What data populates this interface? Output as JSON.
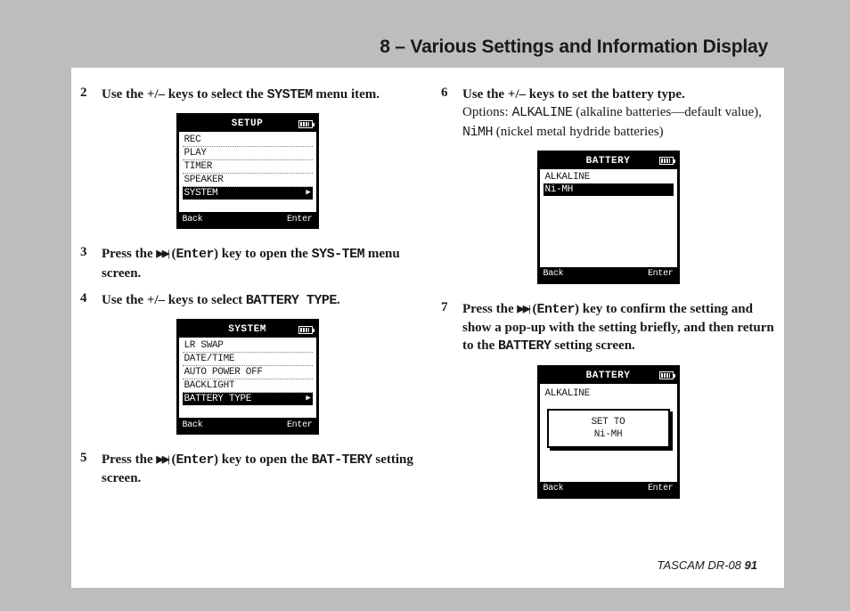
{
  "header": {
    "title": "8 – Various Settings and Information Display"
  },
  "footer": {
    "product": "TASCAM  DR-08",
    "page": "91"
  },
  "left": {
    "s2": {
      "num": "2",
      "pre": "Use the +/– keys to select the ",
      "mono": "SYSTEM",
      "post": " menu item."
    },
    "lcd_setup": {
      "title": "SETUP",
      "rows": [
        "REC",
        "PLAY",
        "TIMER",
        "SPEAKER"
      ],
      "sel": "SYSTEM",
      "back": "Back",
      "enter": "Enter"
    },
    "s3": {
      "num": "3",
      "pre": "Press the ",
      "enter_paren_open": "(",
      "enter_mono": "Enter",
      "enter_paren_close": ")",
      "mid": " key to open the ",
      "mono": "SYS-TEM",
      "post": " menu screen."
    },
    "s4": {
      "num": "4",
      "pre": "Use the +/– keys to select ",
      "mono": "BATTERY TYPE",
      "post": "."
    },
    "lcd_system": {
      "title": "SYSTEM",
      "rows": [
        "LR SWAP",
        "DATE/TIME",
        "AUTO POWER OFF",
        "BACKLIGHT"
      ],
      "sel": "BATTERY TYPE",
      "back": "Back",
      "enter": "Enter"
    },
    "s5": {
      "num": "5",
      "pre": "Press the ",
      "enter_paren_open": "(",
      "enter_mono": "Enter",
      "enter_paren_close": ")",
      "mid": " key to open the ",
      "mono": "BAT-TERY",
      "post": " setting screen."
    }
  },
  "right": {
    "s6": {
      "num": "6",
      "line1": "Use the +/– keys to set the battery type.",
      "opts_pre": "Options: ",
      "opt1_mono": "ALKALINE",
      "opt1_desc": " (alkaline batteries—default value), ",
      "opt2_mono": "NiMH",
      "opt2_desc": " (nickel metal hydride batteries)"
    },
    "lcd_batt": {
      "title": "BATTERY",
      "row1": "ALKALINE",
      "sel": "Ni-MH",
      "back": "Back",
      "enter": "Enter"
    },
    "s7": {
      "num": "7",
      "pre": "Press the ",
      "enter_paren_open": "(",
      "enter_mono": "Enter",
      "enter_paren_close": ")",
      "mid": " key to confirm the setting and show a pop-up with the setting briefly, and then return to the ",
      "mono": "BATTERY",
      "post": " setting screen."
    },
    "lcd_popup": {
      "title": "BATTERY",
      "row1": "ALKALINE",
      "popup_l1": "SET TO",
      "popup_l2": "Ni-MH",
      "back": "Back",
      "enter": "Enter"
    }
  }
}
